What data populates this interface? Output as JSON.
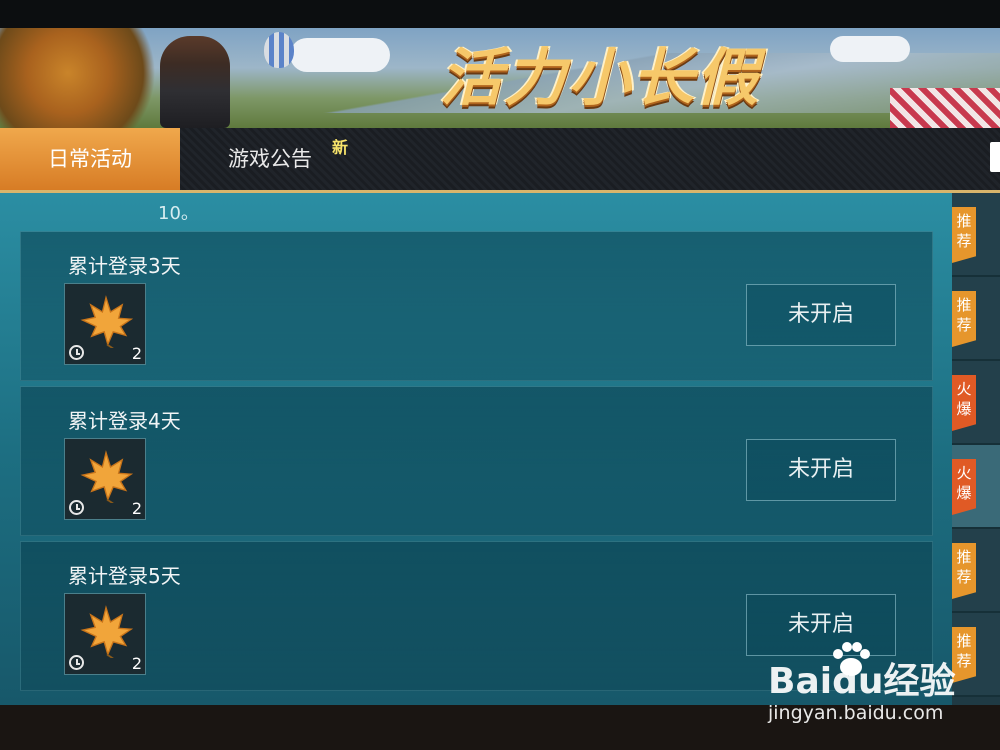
{
  "banner": {
    "title": "活力小长假"
  },
  "tabs": [
    {
      "label": "日常活动",
      "active": true
    },
    {
      "label": "游戏公告",
      "active": false,
      "badge": "新"
    }
  ],
  "content": {
    "scroll_fragment": "10。",
    "cards": [
      {
        "title": "累计登录3天",
        "reward_icon": "maple-leaf-icon",
        "reward_count": "2",
        "status": "未开启"
      },
      {
        "title": "累计登录4天",
        "reward_icon": "maple-leaf-icon",
        "reward_count": "2",
        "status": "未开启"
      },
      {
        "title": "累计登录5天",
        "reward_icon": "maple-leaf-icon",
        "reward_count": "2",
        "status": "未开启"
      }
    ]
  },
  "side_tags": [
    {
      "label": "推荐",
      "kind": "recommend",
      "active": false
    },
    {
      "label": "推荐",
      "kind": "recommend",
      "active": false
    },
    {
      "label": "火爆",
      "kind": "hot",
      "active": false
    },
    {
      "label": "火爆",
      "kind": "hot",
      "active": true
    },
    {
      "label": "推荐",
      "kind": "recommend",
      "active": false
    },
    {
      "label": "推荐",
      "kind": "recommend",
      "active": false
    }
  ],
  "watermark": {
    "logo": "Baidu经验",
    "url": "jingyan.baidu.com"
  },
  "colors": {
    "accent": "#e6962c",
    "hot": "#e05a25",
    "panel": "#1d6f82",
    "tab_active": "#d77c25"
  }
}
